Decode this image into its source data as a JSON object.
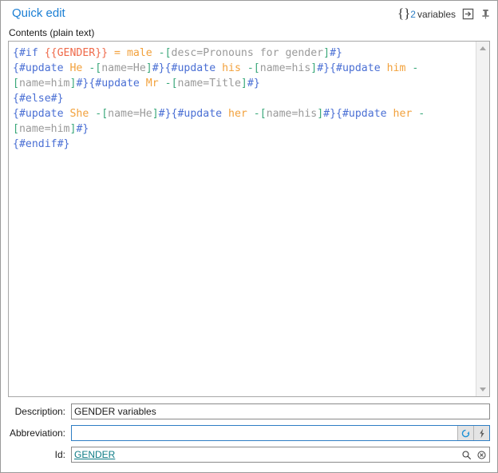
{
  "window": {
    "title": "Quick edit"
  },
  "header": {
    "variables_brace_open": "{",
    "variables_brace_close": "}",
    "variables_count": "2",
    "variables_word": "variables",
    "expand_icon": "expand-window-icon",
    "pin_icon": "pin-icon"
  },
  "contents": {
    "label": "Contents (plain text)",
    "lines": [
      [
        {
          "t": "{#if ",
          "c": "tk-kw"
        },
        {
          "t": "{{GENDER}}",
          "c": "tk-var"
        },
        {
          "t": " = ",
          "c": "tk-eq"
        },
        {
          "t": "male",
          "c": "tk-val"
        },
        {
          "t": " ",
          "c": "tk-plain"
        },
        {
          "t": "-[",
          "c": "tk-brk"
        },
        {
          "t": "desc=Pronouns for gender",
          "c": "tk-attr"
        },
        {
          "t": "]",
          "c": "tk-brk"
        },
        {
          "t": "#}",
          "c": "tk-kw"
        }
      ],
      [
        {
          "t": "{#update ",
          "c": "tk-kw"
        },
        {
          "t": "He",
          "c": "tk-val"
        },
        {
          "t": " ",
          "c": "tk-plain"
        },
        {
          "t": "-[",
          "c": "tk-brk"
        },
        {
          "t": "name=He",
          "c": "tk-attr"
        },
        {
          "t": "]",
          "c": "tk-brk"
        },
        {
          "t": "#}{#update ",
          "c": "tk-kw"
        },
        {
          "t": "his",
          "c": "tk-val"
        },
        {
          "t": " ",
          "c": "tk-plain"
        },
        {
          "t": "-[",
          "c": "tk-brk"
        },
        {
          "t": "name=his",
          "c": "tk-attr"
        },
        {
          "t": "]",
          "c": "tk-brk"
        },
        {
          "t": "#}{#update ",
          "c": "tk-kw"
        },
        {
          "t": "him",
          "c": "tk-val"
        },
        {
          "t": " ",
          "c": "tk-plain"
        },
        {
          "t": "-[",
          "c": "tk-brk"
        },
        {
          "t": "name=him",
          "c": "tk-attr"
        },
        {
          "t": "]",
          "c": "tk-brk"
        },
        {
          "t": "#}{#update ",
          "c": "tk-kw"
        },
        {
          "t": "Mr",
          "c": "tk-val"
        },
        {
          "t": " ",
          "c": "tk-plain"
        },
        {
          "t": "-[",
          "c": "tk-brk"
        },
        {
          "t": "name=Title",
          "c": "tk-attr"
        },
        {
          "t": "]",
          "c": "tk-brk"
        },
        {
          "t": "#}",
          "c": "tk-kw"
        }
      ],
      [
        {
          "t": "{#else#}",
          "c": "tk-kw"
        }
      ],
      [
        {
          "t": "{#update ",
          "c": "tk-kw"
        },
        {
          "t": "She",
          "c": "tk-val"
        },
        {
          "t": " ",
          "c": "tk-plain"
        },
        {
          "t": "-[",
          "c": "tk-brk"
        },
        {
          "t": "name=He",
          "c": "tk-attr"
        },
        {
          "t": "]",
          "c": "tk-brk"
        },
        {
          "t": "#}{#update ",
          "c": "tk-kw"
        },
        {
          "t": "her",
          "c": "tk-val"
        },
        {
          "t": " ",
          "c": "tk-plain"
        },
        {
          "t": "-[",
          "c": "tk-brk"
        },
        {
          "t": "name=his",
          "c": "tk-attr"
        },
        {
          "t": "]",
          "c": "tk-brk"
        },
        {
          "t": "#}{#update ",
          "c": "tk-kw"
        },
        {
          "t": "her",
          "c": "tk-val"
        },
        {
          "t": " ",
          "c": "tk-plain"
        },
        {
          "t": "-[",
          "c": "tk-brk"
        },
        {
          "t": "name=him",
          "c": "tk-attr"
        },
        {
          "t": "]",
          "c": "tk-brk"
        },
        {
          "t": "#}",
          "c": "tk-kw"
        }
      ],
      [
        {
          "t": "{#endif#}",
          "c": "tk-kw"
        }
      ]
    ]
  },
  "scrollbar": {
    "up_icon": "chevron-up-icon",
    "down_icon": "chevron-down-icon"
  },
  "form": {
    "description": {
      "label": "Description:",
      "value": "GENDER variables",
      "placeholder": ""
    },
    "abbreviation": {
      "label": "Abbreviation:",
      "value": "",
      "placeholder": "",
      "refresh_icon": "refresh-icon",
      "lightning_icon": "lightning-bolt-icon"
    },
    "id": {
      "label": "Id:",
      "value": "GENDER",
      "search_icon": "search-icon",
      "clear_icon": "clear-circle-icon"
    }
  },
  "colors": {
    "accent": "#1b7fd4",
    "link": "#0e7c86",
    "keyword": "#4a6fd4",
    "variable": "#ef6a4a",
    "value": "#f2a13c",
    "bracket": "#3aa87a",
    "attribute": "#9a9a9a"
  }
}
